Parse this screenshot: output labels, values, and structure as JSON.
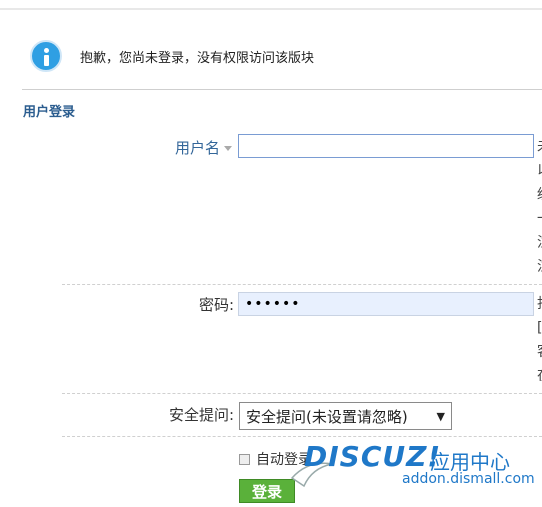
{
  "notice": {
    "text": "抱歉，您尚未登录，没有权限访问该版块",
    "icon": "info-icon"
  },
  "section": {
    "title": "用户登录"
  },
  "form": {
    "username_label": "用户名",
    "password_label": "密码:",
    "password_value": "••••••",
    "question_label": "安全提问:",
    "question_value": "安全提问(未设置请忽略)",
    "remember_label": "自动登录",
    "login_label": "登录",
    "right_hints_1": [
      "未",
      "以",
      "级",
      "一",
      "注",
      "注"
    ],
    "right_hints_2": [
      "找",
      "[",
      "客",
      "在"
    ]
  },
  "watermark": {
    "logo": "DISCUZ!",
    "product": "应用中心",
    "url": "addon.dismall.com"
  },
  "colors": {
    "accent": "#2f9fe3",
    "section_title": "#2b5d8f",
    "button": "#5ab13a",
    "watermark": "#1f78c8"
  }
}
